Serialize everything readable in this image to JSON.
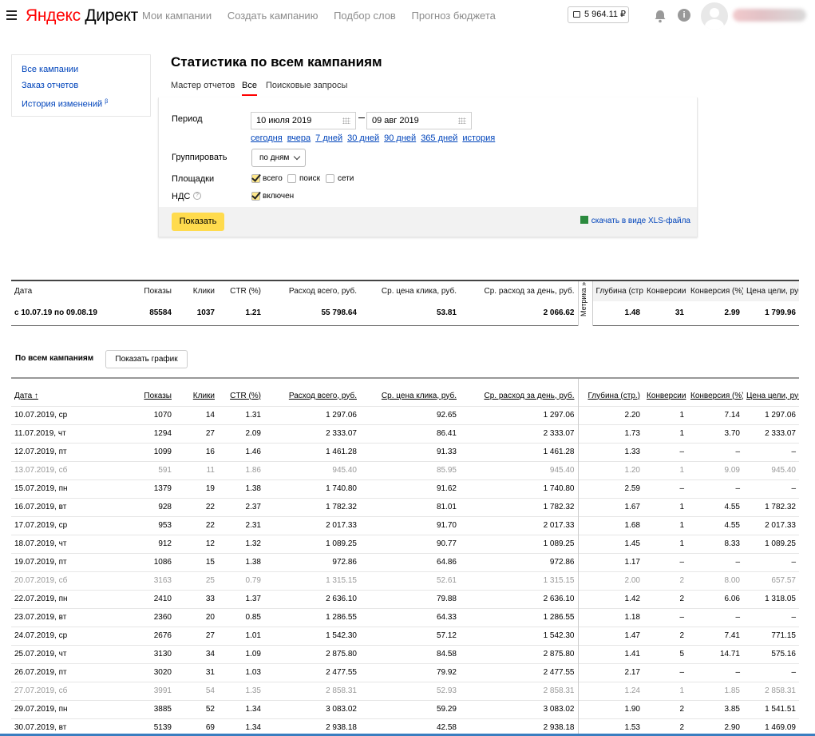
{
  "header": {
    "logo_brand": "Яндекс",
    "logo_product": "Директ",
    "nav": [
      "Мои кампании",
      "Создать кампанию",
      "Подбор слов",
      "Прогноз бюджета"
    ],
    "balance": "5 964.11 ₽",
    "info_glyph": "i"
  },
  "sidebar": {
    "items": [
      "Все кампании",
      "Заказ отчетов",
      "История изменений"
    ],
    "beta": "β"
  },
  "page": {
    "title": "Статистика по всем кампаниям",
    "tabs": [
      "Мастер отчетов",
      "Все",
      "Поисковые запросы"
    ],
    "active_tab": "Все"
  },
  "filters": {
    "period_label": "Период",
    "date_from": "10 июля 2019",
    "date_to": "09 авг 2019",
    "quick_ranges": [
      "сегодня",
      "вчера",
      "7 дней",
      "30 дней",
      "90 дней",
      "365 дней",
      "история"
    ],
    "group_label": "Группировать",
    "group_value": "по дням",
    "placements_label": "Площадки",
    "placements": [
      {
        "label": "всего",
        "checked": true
      },
      {
        "label": "поиск",
        "checked": false
      },
      {
        "label": "сети",
        "checked": false
      }
    ],
    "vat_label": "НДС",
    "vat_help": "?",
    "vat_option": "включен",
    "show_button": "Показать",
    "xls_link": "скачать в виде XLS-файла"
  },
  "summary": {
    "headers": [
      "Дата",
      "Показы",
      "Клики",
      "CTR (%)",
      "Расход всего, руб.",
      "Ср. цена клика, руб.",
      "Ср. расход за день, руб.",
      "Глубина (стр.)",
      "Конверсии",
      "Конверсия (%)",
      "Цена цели, руб."
    ],
    "metrika_label": "Метрика »",
    "row": [
      "с 10.07.19 по 09.08.19",
      "85584",
      "1037",
      "1.21",
      "55 798.64",
      "53.81",
      "2 066.62",
      "1.48",
      "31",
      "2.99",
      "1 799.96"
    ]
  },
  "campaigns": {
    "title": "По всем кампаниям",
    "graph_button": "Показать график",
    "headers": [
      "Дата ↑",
      "Показы",
      "Клики",
      "CTR (%)",
      "Расход всего, руб.",
      "Ср. цена клика, руб.",
      "Ср. расход за день, руб.",
      "Глубина (стр.)",
      "Конверсии",
      "Конверсия (%)",
      "Цена цели, руб."
    ],
    "rows": [
      {
        "weekend": false,
        "cells": [
          "10.07.2019, ср",
          "1070",
          "14",
          "1.31",
          "1 297.06",
          "92.65",
          "1 297.06",
          "2.20",
          "1",
          "7.14",
          "1 297.06"
        ]
      },
      {
        "weekend": false,
        "cells": [
          "11.07.2019, чт",
          "1294",
          "27",
          "2.09",
          "2 333.07",
          "86.41",
          "2 333.07",
          "1.73",
          "1",
          "3.70",
          "2 333.07"
        ]
      },
      {
        "weekend": false,
        "cells": [
          "12.07.2019, пт",
          "1099",
          "16",
          "1.46",
          "1 461.28",
          "91.33",
          "1 461.28",
          "1.33",
          "–",
          "–",
          "–"
        ]
      },
      {
        "weekend": true,
        "cells": [
          "13.07.2019, сб",
          "591",
          "11",
          "1.86",
          "945.40",
          "85.95",
          "945.40",
          "1.20",
          "1",
          "9.09",
          "945.40"
        ]
      },
      {
        "weekend": false,
        "cells": [
          "15.07.2019, пн",
          "1379",
          "19",
          "1.38",
          "1 740.80",
          "91.62",
          "1 740.80",
          "2.59",
          "–",
          "–",
          "–"
        ]
      },
      {
        "weekend": false,
        "cells": [
          "16.07.2019, вт",
          "928",
          "22",
          "2.37",
          "1 782.32",
          "81.01",
          "1 782.32",
          "1.67",
          "1",
          "4.55",
          "1 782.32"
        ]
      },
      {
        "weekend": false,
        "cells": [
          "17.07.2019, ср",
          "953",
          "22",
          "2.31",
          "2 017.33",
          "91.70",
          "2 017.33",
          "1.68",
          "1",
          "4.55",
          "2 017.33"
        ]
      },
      {
        "weekend": false,
        "cells": [
          "18.07.2019, чт",
          "912",
          "12",
          "1.32",
          "1 089.25",
          "90.77",
          "1 089.25",
          "1.45",
          "1",
          "8.33",
          "1 089.25"
        ]
      },
      {
        "weekend": false,
        "cells": [
          "19.07.2019, пт",
          "1086",
          "15",
          "1.38",
          "972.86",
          "64.86",
          "972.86",
          "1.17",
          "–",
          "–",
          "–"
        ]
      },
      {
        "weekend": true,
        "cells": [
          "20.07.2019, сб",
          "3163",
          "25",
          "0.79",
          "1 315.15",
          "52.61",
          "1 315.15",
          "2.00",
          "2",
          "8.00",
          "657.57"
        ]
      },
      {
        "weekend": false,
        "cells": [
          "22.07.2019, пн",
          "2410",
          "33",
          "1.37",
          "2 636.10",
          "79.88",
          "2 636.10",
          "1.42",
          "2",
          "6.06",
          "1 318.05"
        ]
      },
      {
        "weekend": false,
        "cells": [
          "23.07.2019, вт",
          "2360",
          "20",
          "0.85",
          "1 286.55",
          "64.33",
          "1 286.55",
          "1.18",
          "–",
          "–",
          "–"
        ]
      },
      {
        "weekend": false,
        "cells": [
          "24.07.2019, ср",
          "2676",
          "27",
          "1.01",
          "1 542.30",
          "57.12",
          "1 542.30",
          "1.47",
          "2",
          "7.41",
          "771.15"
        ]
      },
      {
        "weekend": false,
        "cells": [
          "25.07.2019, чт",
          "3130",
          "34",
          "1.09",
          "2 875.80",
          "84.58",
          "2 875.80",
          "1.41",
          "5",
          "14.71",
          "575.16"
        ]
      },
      {
        "weekend": false,
        "cells": [
          "26.07.2019, пт",
          "3020",
          "31",
          "1.03",
          "2 477.55",
          "79.92",
          "2 477.55",
          "2.17",
          "–",
          "–",
          "–"
        ]
      },
      {
        "weekend": true,
        "cells": [
          "27.07.2019, сб",
          "3991",
          "54",
          "1.35",
          "2 858.31",
          "52.93",
          "2 858.31",
          "1.24",
          "1",
          "1.85",
          "2 858.31"
        ]
      },
      {
        "weekend": false,
        "cells": [
          "29.07.2019, пн",
          "3885",
          "52",
          "1.34",
          "3 083.02",
          "59.29",
          "3 083.02",
          "1.90",
          "2",
          "3.85",
          "1 541.51"
        ]
      },
      {
        "weekend": false,
        "cells": [
          "30.07.2019, вт",
          "5139",
          "69",
          "1.34",
          "2 938.18",
          "42.58",
          "2 938.18",
          "1.53",
          "2",
          "2.90",
          "1 469.09"
        ]
      }
    ]
  }
}
